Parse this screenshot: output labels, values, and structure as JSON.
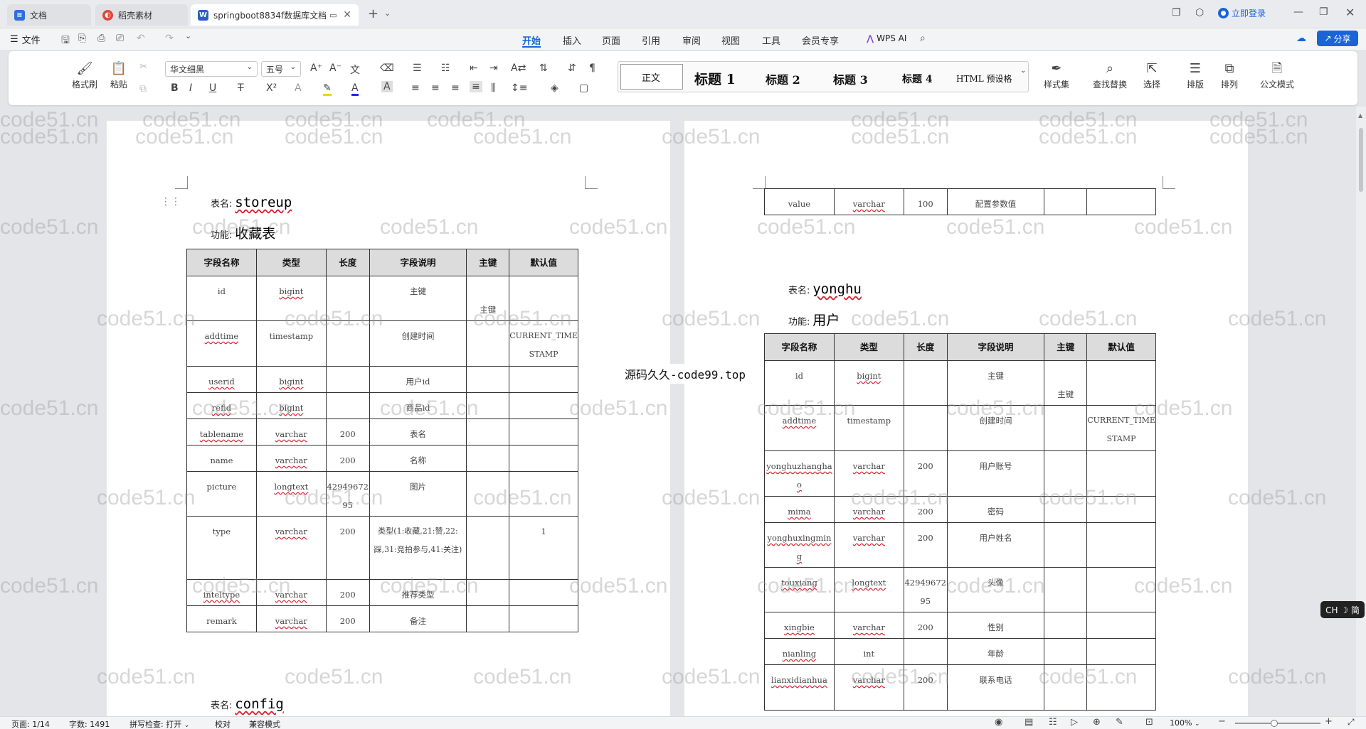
{
  "tabs": [
    {
      "label": "文档",
      "icon": "docs-icon",
      "active": false
    },
    {
      "label": "稻壳素材",
      "icon": "docer-icon",
      "active": false
    },
    {
      "label": "springboot8834f数据库文档",
      "icon": "word-doc-icon",
      "active": true
    }
  ],
  "titlebar": {
    "login": "立即登录"
  },
  "menubar": {
    "file": "文件",
    "items": [
      "开始",
      "插入",
      "页面",
      "引用",
      "审阅",
      "视图",
      "工具",
      "会员专享"
    ],
    "active": "开始",
    "wps_ai": "WPS AI",
    "share": "分享"
  },
  "ribbon": {
    "format_painter": "格式刷",
    "paste": "粘贴",
    "font": "华文细黑",
    "size": "五号",
    "styles": [
      {
        "label": "正文"
      },
      {
        "label": "标题 1"
      },
      {
        "label": "标题 2"
      },
      {
        "label": "标题 3"
      },
      {
        "label": "标题 4"
      },
      {
        "label": "HTML 预设格"
      }
    ],
    "style_set": "样式集",
    "find_replace": "查找替换",
    "select": "选择",
    "layout": "排版",
    "arrange": "排列",
    "official_mode": "公文模式"
  },
  "doc": {
    "table_label": "表名:",
    "func_label": "功能:",
    "headers": [
      "字段名称",
      "类型",
      "长度",
      "字段说明",
      "主键",
      "默认值"
    ],
    "storeup": {
      "name": "storeup",
      "func": "收藏表",
      "rows": [
        [
          "id",
          "bigint",
          "",
          "主键",
          "主键",
          ""
        ],
        [
          "addtime",
          "timestamp",
          "",
          "创建时间",
          "",
          "CURRENT_TIMESTAMP"
        ],
        [
          "userid",
          "bigint",
          "",
          "用户id",
          "",
          ""
        ],
        [
          "refid",
          "bigint",
          "",
          "商品id",
          "",
          ""
        ],
        [
          "tablename",
          "varchar",
          "200",
          "表名",
          "",
          ""
        ],
        [
          "name",
          "varchar",
          "200",
          "名称",
          "",
          ""
        ],
        [
          "picture",
          "longtext",
          "4294967295",
          "图片",
          "",
          ""
        ],
        [
          "type",
          "varchar",
          "200",
          "类型(1:收藏,21:赞,22:踩,31:竞拍参与,41:关注)",
          "",
          "1"
        ],
        [
          "inteltype",
          "varchar",
          "200",
          "推荐类型",
          "",
          ""
        ],
        [
          "remark",
          "varchar",
          "200",
          "备注",
          "",
          ""
        ]
      ]
    },
    "config": {
      "name": "config"
    },
    "config_tail": {
      "row": [
        "value",
        "varchar",
        "100",
        "配置参数值",
        "",
        ""
      ]
    },
    "yonghu": {
      "name": "yonghu",
      "func": "用户",
      "rows": [
        [
          "id",
          "bigint",
          "",
          "主键",
          "主键",
          ""
        ],
        [
          "addtime",
          "timestamp",
          "",
          "创建时间",
          "",
          "CURRENT_TIMESTAMP"
        ],
        [
          "yonghuzhanghao",
          "varchar",
          "200",
          "用户账号",
          "",
          ""
        ],
        [
          "mima",
          "varchar",
          "200",
          "密码",
          "",
          ""
        ],
        [
          "yonghuxingming",
          "varchar",
          "200",
          "用户姓名",
          "",
          ""
        ],
        [
          "touxiang",
          "longtext",
          "4294967295",
          "头像",
          "",
          ""
        ],
        [
          "xingbie",
          "varchar",
          "200",
          "性别",
          "",
          ""
        ],
        [
          "nianling",
          "int",
          "",
          "年龄",
          "",
          ""
        ],
        [
          "lianxidianhua",
          "varchar",
          "200",
          "联系电话",
          "",
          ""
        ]
      ]
    },
    "overlay": "源码久久-code99.top",
    "watermark": "code51.cn"
  },
  "ime": "CH ☽ 简",
  "status": {
    "page": "页面: 1/14",
    "words": "字数: 1491",
    "spell": "拼写检查: 打开",
    "proof": "校对",
    "compat": "兼容模式",
    "zoom": "100%"
  }
}
